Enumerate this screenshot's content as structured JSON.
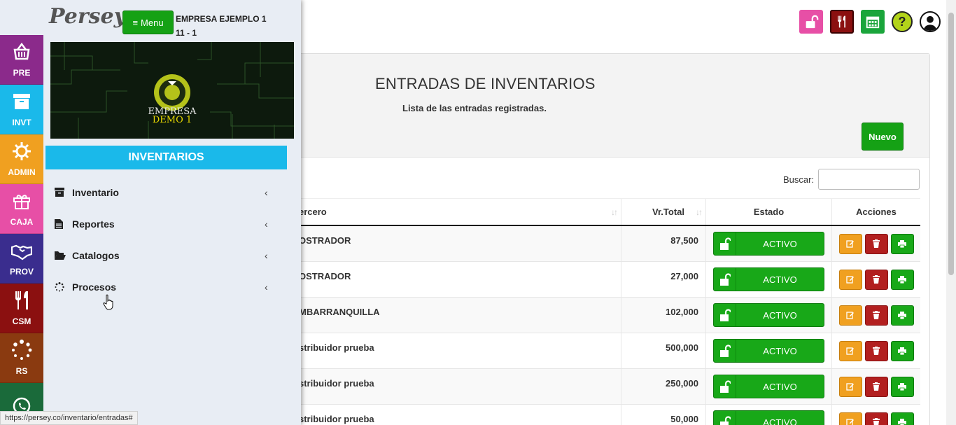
{
  "brand": {
    "name": "Persey",
    "menu_label": "Menu"
  },
  "company": {
    "name": "EMPRESA EJEMPLO 1",
    "code": "11 - 1"
  },
  "banner": {
    "line1": "EMPRESA",
    "line2": "DEMO 1"
  },
  "modules": [
    {
      "label": "PRE",
      "color": "#8b2a8b",
      "icon": "basket-icon"
    },
    {
      "label": "INVT",
      "color": "#1ab9ea",
      "icon": "archive-icon"
    },
    {
      "label": "ADMIN",
      "color": "#f0a020",
      "icon": "gear-icon"
    },
    {
      "label": "CAJA",
      "color": "#e74fa6",
      "icon": "gift-icon"
    },
    {
      "label": "PROV",
      "color": "#3a2d8e",
      "icon": "handshake-icon"
    },
    {
      "label": "CSM",
      "color": "#8b1010",
      "icon": "fork-knife-icon"
    },
    {
      "label": "RS",
      "color": "#8a3a10",
      "icon": "spinner-icon"
    },
    {
      "label": "",
      "color": "#1a6a3a",
      "icon": "whatsapp-icon"
    }
  ],
  "sidebar": {
    "section_title": "INVENTARIOS",
    "items": [
      {
        "label": "Inventario",
        "icon": "archive-icon"
      },
      {
        "label": "Reportes",
        "icon": "file-icon"
      },
      {
        "label": "Catalogos",
        "icon": "folder-open-icon"
      },
      {
        "label": "Procesos",
        "icon": "spinner-icon"
      }
    ]
  },
  "page": {
    "title": "ENTRADAS DE INVENTARIOS",
    "subtitle": "Lista de las entradas registradas.",
    "new_button": "Nuevo",
    "search_label": "Buscar:",
    "search_value": ""
  },
  "table": {
    "columns": [
      "Tercero",
      "Vr.Total",
      "Estado",
      "Acciones"
    ],
    "visible_columns": [
      "ercero",
      "Vr.Total",
      "Estado",
      "Acciones"
    ],
    "rows": [
      {
        "tercero": "OSTRADOR",
        "total": "87,500",
        "estado": "ACTIVO"
      },
      {
        "tercero": "OSTRADOR",
        "total": "27,000",
        "estado": "ACTIVO"
      },
      {
        "tercero": "MBARRANQUILLA",
        "total": "102,000",
        "estado": "ACTIVO"
      },
      {
        "tercero": "stribuidor prueba",
        "total": "500,000",
        "estado": "ACTIVO"
      },
      {
        "tercero": "stribuidor prueba",
        "total": "250,000",
        "estado": "ACTIVO"
      },
      {
        "tercero": "stribuidor prueba",
        "total": "50,000",
        "estado": "ACTIVO"
      }
    ]
  },
  "status_bar": {
    "url": "https://persey.co/inventario/entradas#"
  },
  "colors": {
    "green": "#15a115",
    "cyan": "#1ab9ea",
    "orange": "#f0a020",
    "red": "#b21f1f"
  }
}
